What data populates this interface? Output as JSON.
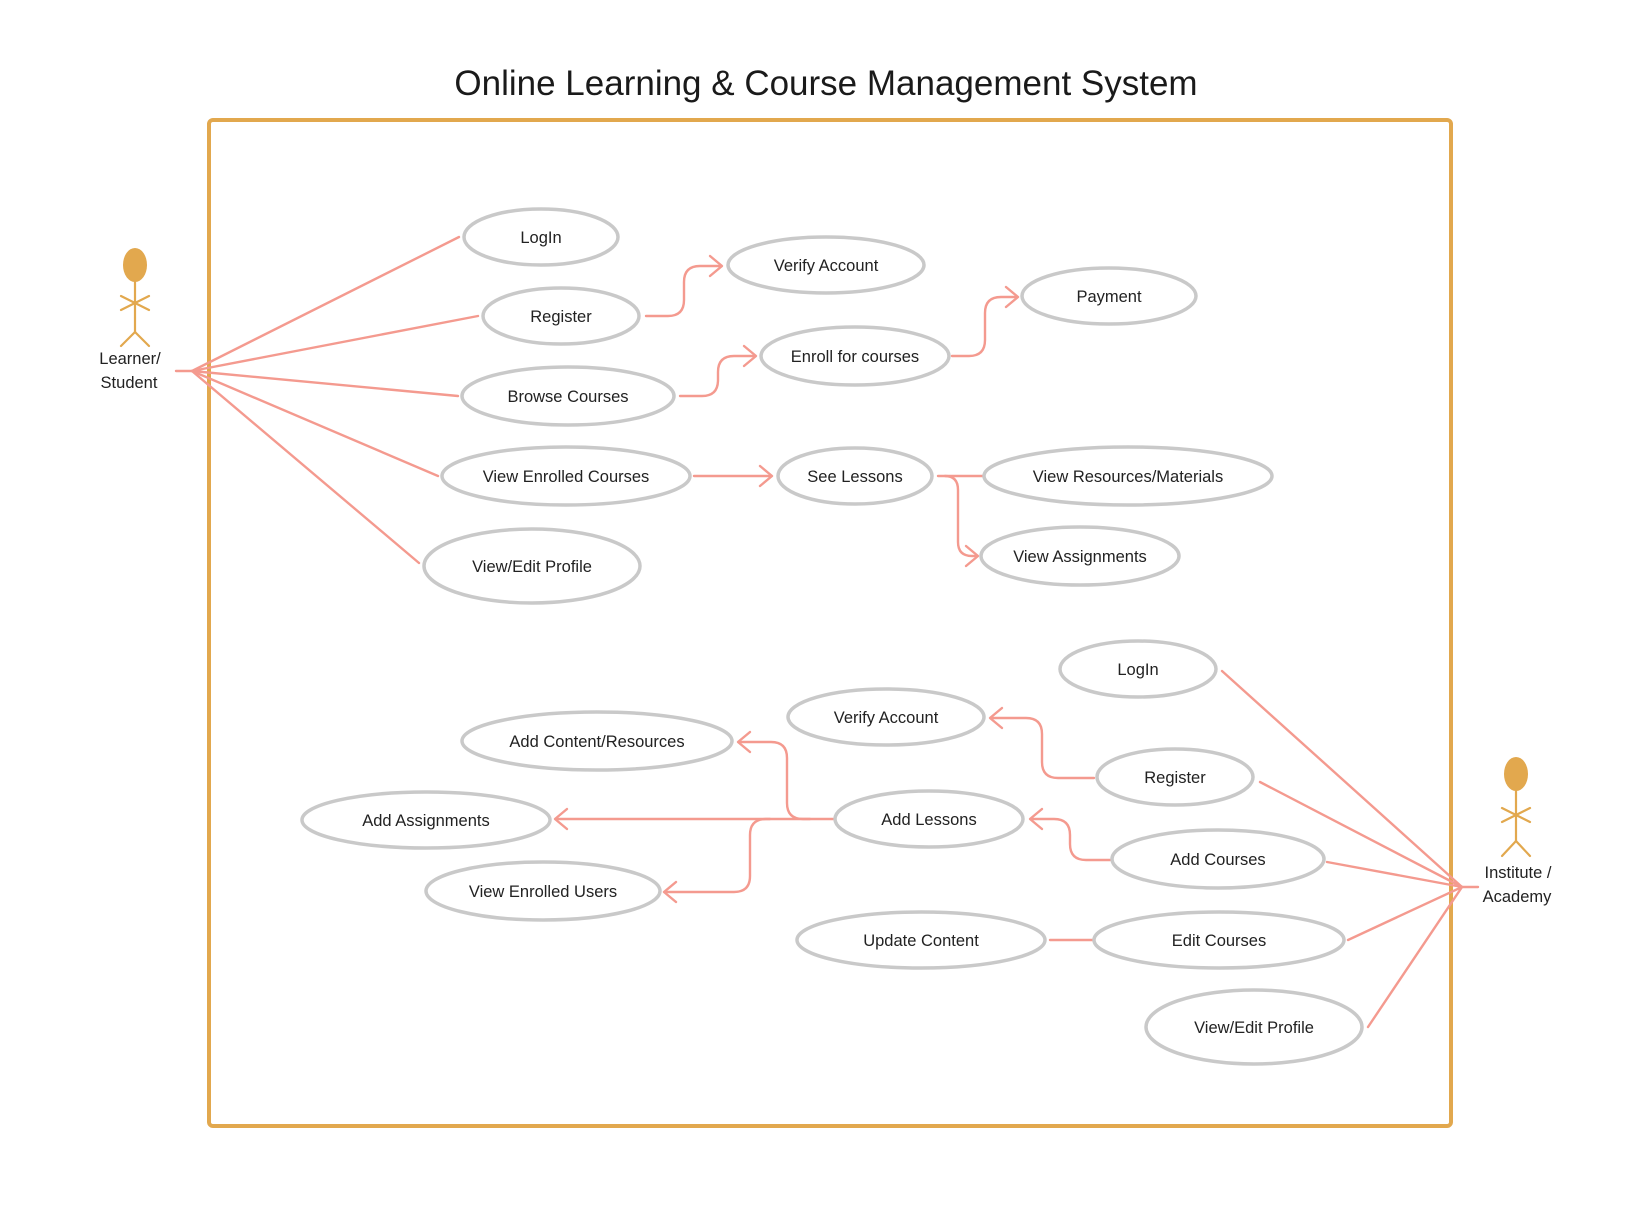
{
  "title": "Online Learning & Course Management System",
  "colors": {
    "boundary": "#e2a84e",
    "actor": "#e2a84e",
    "connector": "#f49a8f",
    "usecase_border": "#c9c9c9",
    "text": "#222222"
  },
  "actors": {
    "learner": {
      "line1": "Learner/",
      "line2": "Student"
    },
    "institute": {
      "line1": "Institute /",
      "line2": "Academy"
    }
  },
  "learner_usecases": {
    "login": "LogIn",
    "register": "Register",
    "verify_account": "Verify Account",
    "browse_courses": "Browse Courses",
    "enroll": "Enroll for courses",
    "payment": "Payment",
    "view_enrolled_courses": "View Enrolled Courses",
    "see_lessons": "See Lessons",
    "view_resources": "View Resources/Materials",
    "view_assignments": "View Assignments",
    "view_edit_profile": "View/Edit Profile"
  },
  "institute_usecases": {
    "login": "LogIn",
    "verify_account": "Verify Account",
    "register": "Register",
    "add_content": "Add Content/Resources",
    "add_assignments": "Add Assignments",
    "add_lessons": "Add Lessons",
    "add_courses": "Add Courses",
    "view_enrolled_users": "View Enrolled Users",
    "update_content": "Update Content",
    "edit_courses": "Edit Courses",
    "view_edit_profile": "View/Edit Profile"
  }
}
